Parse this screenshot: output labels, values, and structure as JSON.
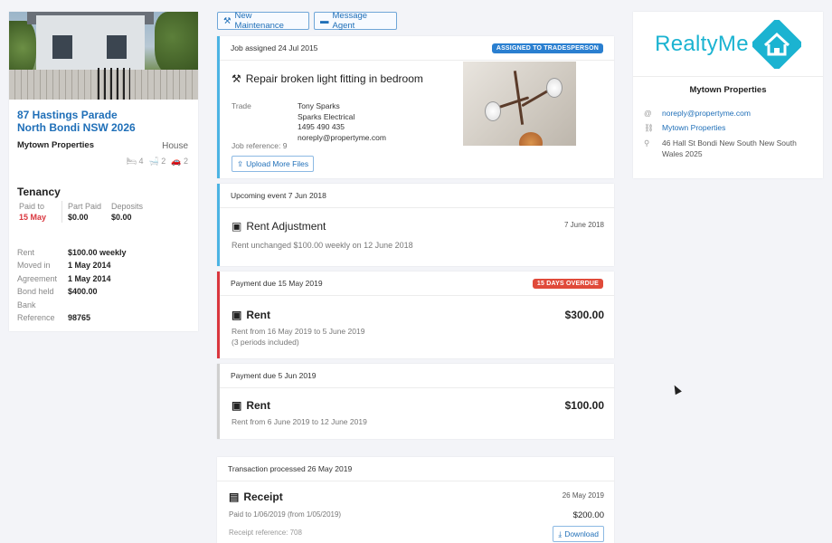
{
  "property": {
    "address_line1": "87 Hastings Parade",
    "address_line2": "North Bondi NSW 2026",
    "agency": "Mytown Properties",
    "type": "House",
    "beds": "4",
    "baths": "2",
    "cars": "2"
  },
  "tenancy": {
    "heading": "Tenancy",
    "paid_to_label": "Paid to",
    "paid_to_value": "15 May",
    "part_paid_label": "Part Paid",
    "part_paid_value": "$0.00",
    "deposits_label": "Deposits",
    "deposits_value": "$0.00",
    "details": [
      {
        "label": "Rent",
        "value": "$100.00 weekly"
      },
      {
        "label": "Moved in",
        "value": "1 May 2014"
      },
      {
        "label": "Agreement",
        "value": "1 May 2014"
      },
      {
        "label": "Bond held",
        "value": "$400.00"
      },
      {
        "label": "Bank",
        "value": ""
      },
      {
        "label": "Reference",
        "value": "98765"
      }
    ]
  },
  "actions": {
    "new_maintenance": "New Maintenance",
    "message_agent": "Message Agent"
  },
  "feed": {
    "job": {
      "header": "Job assigned 24 Jul 2015",
      "badge": "ASSIGNED TO TRADESPERSON",
      "title": "Repair broken light fitting in bedroom",
      "trade_label": "Trade",
      "trade_name": "Tony Sparks",
      "trade_company": "Sparks Electrical",
      "trade_phone": "1495 490 435",
      "trade_email": "noreply@propertyme.com",
      "reference": "Job reference: 9",
      "upload_label": "Upload More Files"
    },
    "event": {
      "header": "Upcoming event 7 Jun 2018",
      "title": "Rent Adjustment",
      "date": "7 June 2018",
      "desc": "Rent unchanged $100.00 weekly on 12 June 2018"
    },
    "payment_overdue": {
      "header": "Payment due 15 May 2019",
      "badge": "15 DAYS OVERDUE",
      "title": "Rent",
      "amount": "$300.00",
      "desc": "Rent from 16 May 2019 to 5 June 2019",
      "desc2": "(3 periods included)"
    },
    "payment_due": {
      "header": "Payment due 5 Jun 2019",
      "title": "Rent",
      "amount": "$100.00",
      "desc": "Rent from 6 June 2019 to 12 June 2019"
    },
    "receipt": {
      "header": "Transaction processed 26 May 2019",
      "title": "Receipt",
      "date": "26 May 2019",
      "desc": "Paid to 1/06/2019 (from 1/05/2019)",
      "amount": "$200.00",
      "reference": "Receipt reference: 708",
      "download_label": "Download"
    }
  },
  "agency_card": {
    "logo_text": "RealtyMe",
    "name": "Mytown Properties",
    "email": "noreply@propertyme.com",
    "website": "Mytown Properties",
    "address": "46 Hall St Bondi New South New South Wales 2025"
  },
  "colors": {
    "accent": "#1f6fb8",
    "brand": "#1bb3d1",
    "overdue": "#e04a3a",
    "assigned": "#2a7fd0"
  }
}
